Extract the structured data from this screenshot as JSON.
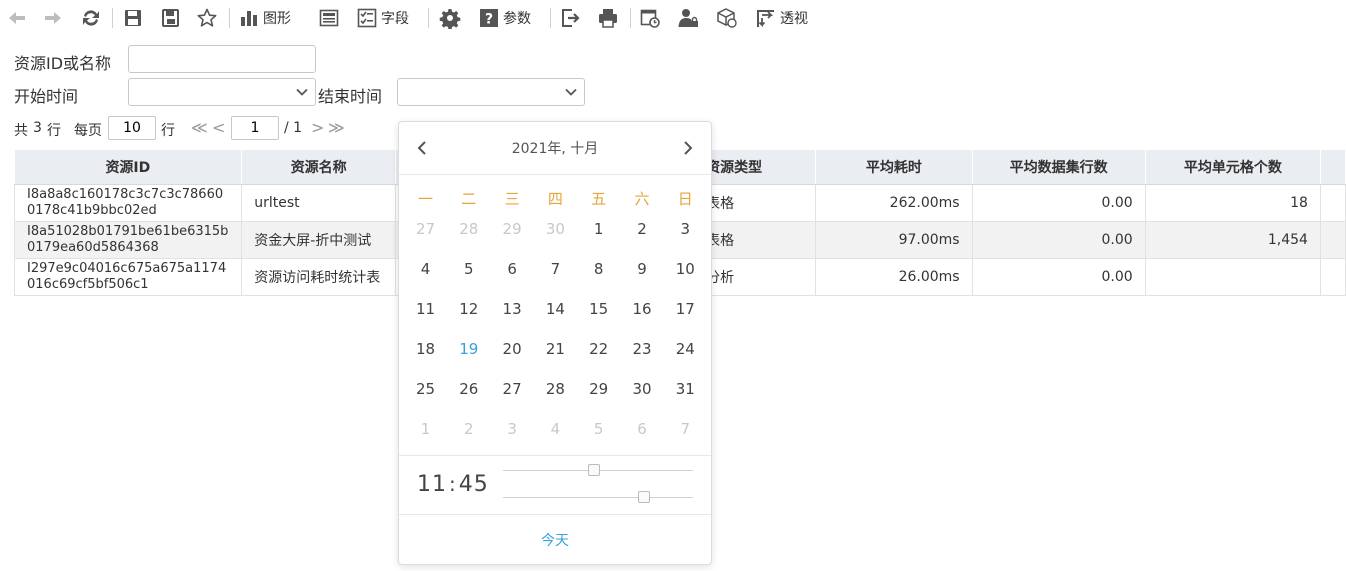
{
  "toolbar": {
    "chart_label": "图形",
    "field_label": "字段",
    "param_label": "参数",
    "pivot_label": "透视"
  },
  "filters": {
    "resource_label": "资源ID或名称",
    "start_label": "开始时间",
    "end_label": "结束时间",
    "resource_value": "",
    "start_value": "",
    "end_value": ""
  },
  "pager": {
    "total_prefix": "共",
    "total": "3",
    "total_suffix": "行",
    "per_page_label": "每页",
    "per_page": "10",
    "per_page_suffix": "行",
    "first": "≪",
    "prev": "<",
    "page": "1",
    "page_total": "/ 1",
    "next": ">",
    "last": "≫"
  },
  "table": {
    "columns": [
      "资源ID",
      "资源名称",
      "资源类型",
      "平均耗时",
      "平均数据集行数",
      "平均单元格个数"
    ],
    "rows": [
      [
        "I8a8a8c160178c3c7c3c786600178c41b9bbc02ed",
        "urltest",
        "表格",
        "262.00ms",
        "0.00",
        "18"
      ],
      [
        "I8a51028b01791be61be6315b0179ea60d5864368",
        "资金大屏-折中测试",
        "表格",
        "97.00ms",
        "0.00",
        "1,454"
      ],
      [
        "I297e9c04016c675a675a1174016c69cf5bf506c1",
        "资源访问耗时统计表",
        "分析",
        "26.00ms",
        "0.00",
        ""
      ]
    ]
  },
  "calendar": {
    "title": "2021年, 十月",
    "weekdays": [
      "一",
      "二",
      "三",
      "四",
      "五",
      "六",
      "日"
    ],
    "weeks": [
      [
        "27",
        "28",
        "29",
        "30",
        "1",
        "2",
        "3"
      ],
      [
        "4",
        "5",
        "6",
        "7",
        "8",
        "9",
        "10"
      ],
      [
        "11",
        "12",
        "13",
        "14",
        "15",
        "16",
        "17"
      ],
      [
        "18",
        "19",
        "20",
        "21",
        "22",
        "23",
        "24"
      ],
      [
        "25",
        "26",
        "27",
        "28",
        "29",
        "30",
        "31"
      ],
      [
        "1",
        "2",
        "3",
        "4",
        "5",
        "6",
        "7"
      ]
    ],
    "today_day": "19",
    "hour": "11",
    "time_sep": ":",
    "minute": "45",
    "hour_fraction": 0.48,
    "minute_fraction": 0.74,
    "today_label": "今天",
    "accent_color": "#3aa0de",
    "weekday_color": "#e8a33c"
  }
}
